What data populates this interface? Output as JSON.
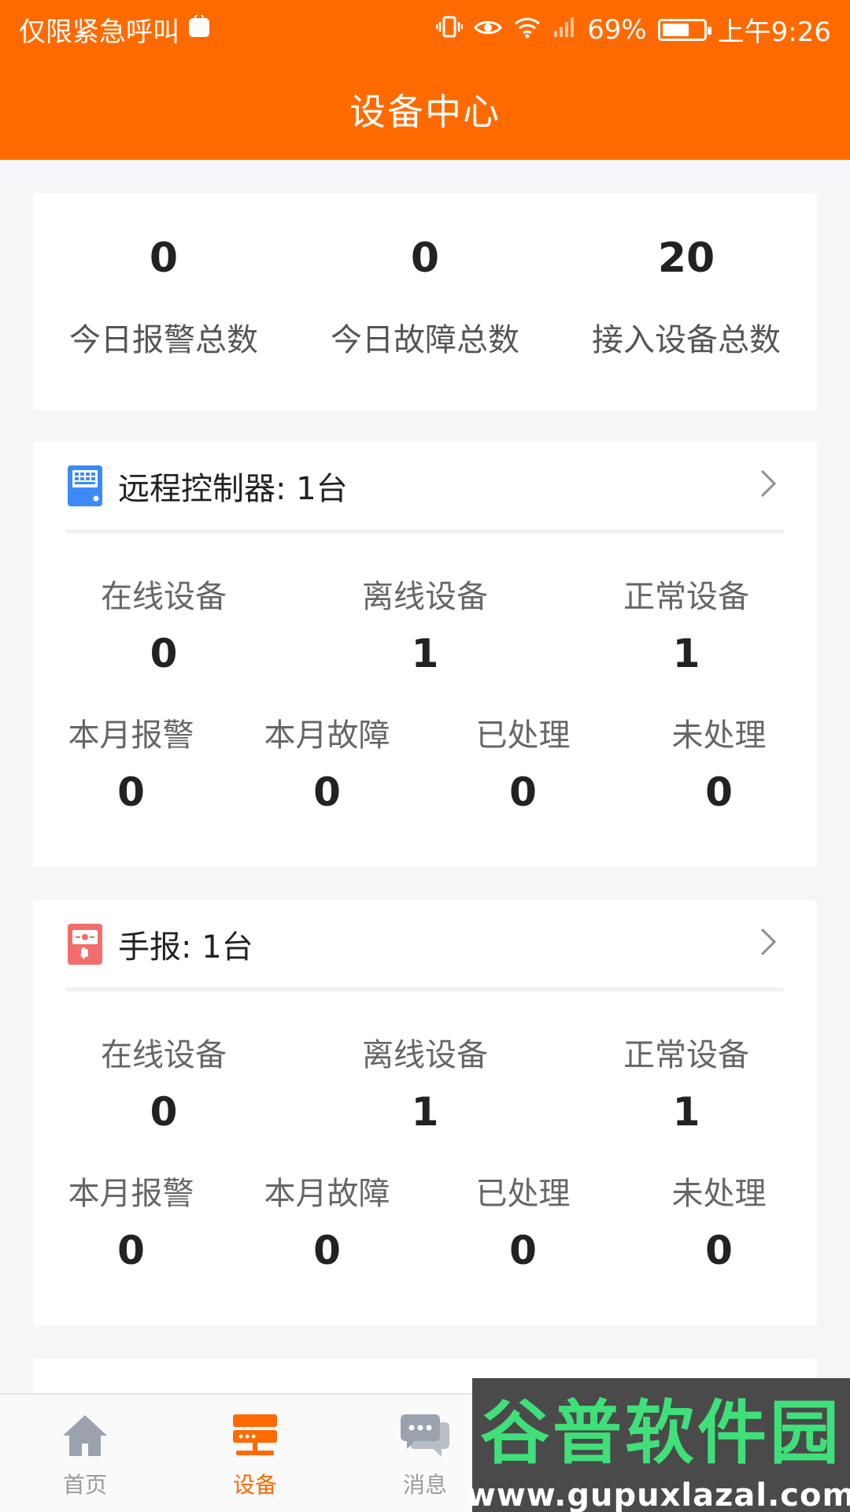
{
  "status_bar": {
    "carrier_text": "仅限紧急呼叫",
    "battery_percent": "69%",
    "time": "上午9:26"
  },
  "header": {
    "title": "设备中心"
  },
  "summary": [
    {
      "value": "0",
      "label": "今日报警总数"
    },
    {
      "value": "0",
      "label": "今日故障总数"
    },
    {
      "value": "20",
      "label": "接入设备总数"
    }
  ],
  "devices": [
    {
      "title": "远程控制器: 1台",
      "icon": "controller-icon",
      "row1": [
        {
          "label": "在线设备",
          "value": "0"
        },
        {
          "label": "离线设备",
          "value": "1"
        },
        {
          "label": "正常设备",
          "value": "1"
        }
      ],
      "row2": [
        {
          "label": "本月报警",
          "value": "0"
        },
        {
          "label": "本月故障",
          "value": "0"
        },
        {
          "label": "已处理",
          "value": "0"
        },
        {
          "label": "未处理",
          "value": "0"
        }
      ]
    },
    {
      "title": "手报: 1台",
      "icon": "manual-alarm-icon",
      "row1": [
        {
          "label": "在线设备",
          "value": "0"
        },
        {
          "label": "离线设备",
          "value": "1"
        },
        {
          "label": "正常设备",
          "value": "1"
        }
      ],
      "row2": [
        {
          "label": "本月报警",
          "value": "0"
        },
        {
          "label": "本月故障",
          "value": "0"
        },
        {
          "label": "已处理",
          "value": "0"
        },
        {
          "label": "未处理",
          "value": "0"
        }
      ]
    }
  ],
  "tabs": [
    {
      "label": "首页",
      "icon": "home-icon",
      "active": false
    },
    {
      "label": "设备",
      "icon": "device-icon",
      "active": true
    },
    {
      "label": "消息",
      "icon": "message-icon",
      "active": false
    }
  ],
  "watermark": {
    "line1": "谷普软件园",
    "line2": "www.gupuxlazal.com"
  },
  "colors": {
    "brand": "#ff6a00",
    "controller_icon": "#3d8af7",
    "manual_alarm_icon": "#f26d6d",
    "tab_inactive": "#9a9a9a"
  }
}
